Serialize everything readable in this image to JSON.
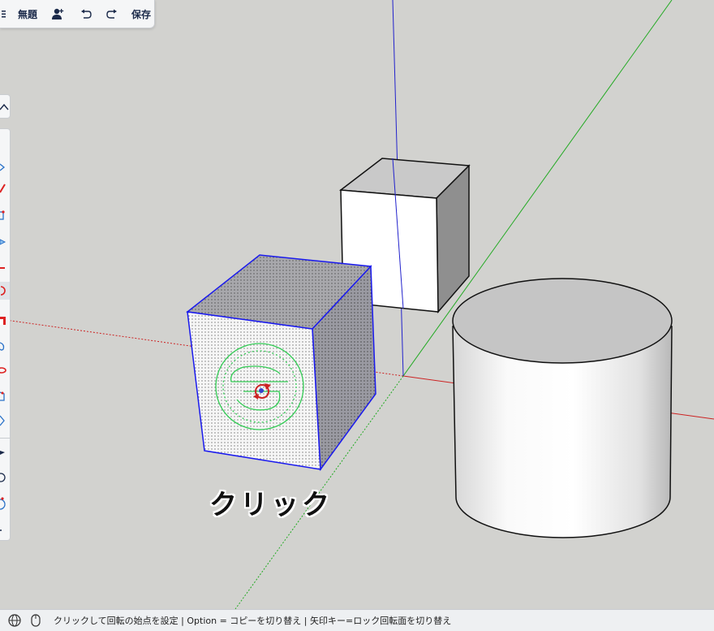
{
  "toolbar_top": {
    "title": "無題",
    "save_label": "保存",
    "icons": [
      "menu-icon",
      "add-user-icon",
      "undo-icon",
      "redo-icon"
    ]
  },
  "caption": "クリック",
  "status": {
    "icons": [
      "globe-icon",
      "mouse-icon"
    ],
    "text": "クリックして回転の始点を設定 | Option = コピーを切り替え | 矢印キー=ロック回転面を切り替え"
  },
  "colors": {
    "background": "#d2d2cf",
    "axis_red": "#cc2222",
    "axis_green": "#22aa22",
    "axis_blue": "#2222cc",
    "selection": "#1a1aee",
    "protractor": "#33cc55"
  },
  "tools": [
    "select-tool-icon",
    "eraser-tool-icon",
    "pencil-tool-icon",
    "rectangle-tool-icon",
    "push-pull-tool-icon",
    "move-tool-icon",
    "rotate-tool-icon",
    "scale-tool-icon",
    "paint-tool-icon",
    "orbit-tool-icon",
    "pan-tool-icon",
    "zoom-tool-icon",
    "tape-measure-tool-icon",
    "circle-tool-icon",
    "protractor-tool-icon",
    "more-tools-icon"
  ]
}
